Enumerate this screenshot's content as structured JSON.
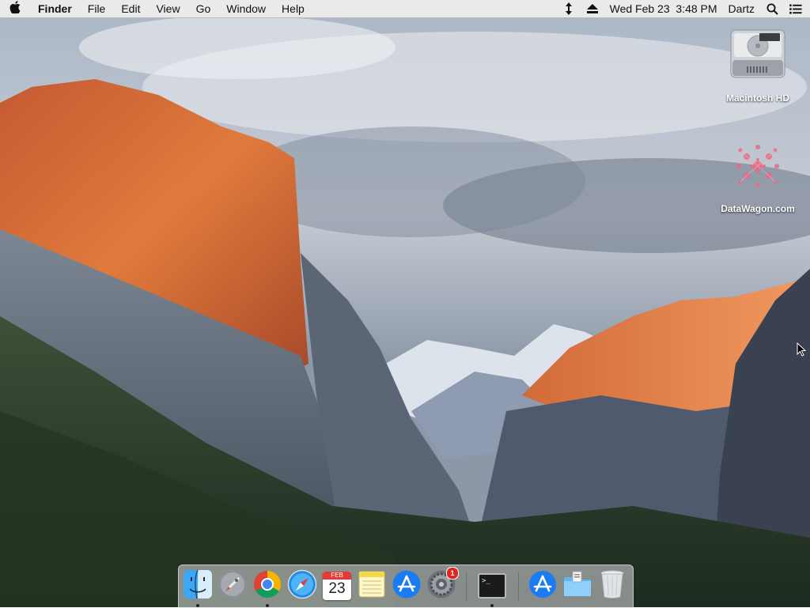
{
  "menubar": {
    "apple_icon": "apple-logo-icon",
    "app_name": "Finder",
    "menus": [
      "File",
      "Edit",
      "View",
      "Go",
      "Window",
      "Help"
    ],
    "datetime": "Wed Feb 23  3:48 PM",
    "user": "Dartz",
    "status_icons": [
      "network-arrows-icon",
      "eject-icon",
      "search-icon",
      "list-icon"
    ]
  },
  "desktop": {
    "icons": [
      {
        "label": "Macintosh HD",
        "icon": "hard-drive-icon"
      },
      {
        "label": "DataWagon.com",
        "icon": "network-volume-icon"
      }
    ]
  },
  "dock": {
    "items": [
      {
        "name": "Finder",
        "icon": "finder-icon",
        "running": true
      },
      {
        "name": "Launchpad",
        "icon": "launchpad-icon",
        "running": false
      },
      {
        "name": "Google Chrome",
        "icon": "chrome-icon",
        "running": true
      },
      {
        "name": "Safari",
        "icon": "safari-icon",
        "running": false
      },
      {
        "name": "Calendar",
        "icon": "calendar-icon",
        "running": false,
        "month": "FEB",
        "day": "23"
      },
      {
        "name": "Notes",
        "icon": "notes-icon",
        "running": false
      },
      {
        "name": "App Store",
        "icon": "app-store-icon",
        "running": false
      },
      {
        "name": "System Preferences",
        "icon": "system-preferences-icon",
        "running": false,
        "badge": "1"
      },
      {
        "name": "Terminal",
        "icon": "terminal-icon",
        "running": true,
        "prompt": ">_"
      },
      {
        "name": "Applications",
        "icon": "applications-folder-icon",
        "running": false
      },
      {
        "name": "Downloads",
        "icon": "downloads-folder-icon",
        "running": false
      },
      {
        "name": "Trash",
        "icon": "trash-icon",
        "running": false
      }
    ]
  },
  "colors": {
    "menubar_bg": "#ececec",
    "dock_bg": "#dcdce1",
    "badge_red": "#e0261f",
    "safari_blue": "#1e88e5",
    "appstore_blue": "#1a7cf0"
  }
}
